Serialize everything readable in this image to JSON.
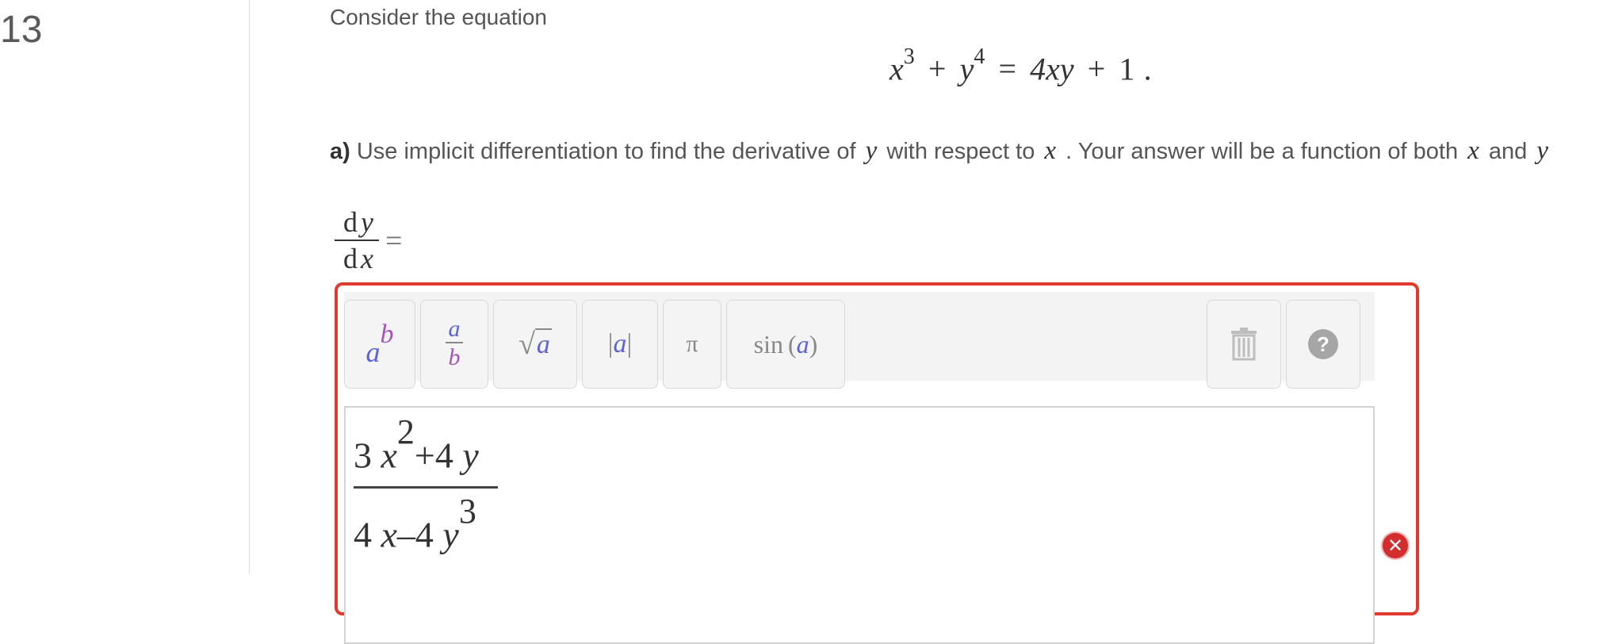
{
  "question": {
    "number": "13",
    "intro": "Consider the equation",
    "equation": {
      "x_var": "x",
      "x_exp": "3",
      "plus": "+",
      "y_var": "y",
      "y_exp": "4",
      "equals": "=",
      "rhs": "4xy",
      "plus2": "+",
      "const": "1",
      "period": "."
    },
    "part_a": {
      "label": "a)",
      "text_1": "Use implicit differentiation to find the derivative of",
      "var_y": "y",
      "text_2": "with respect to",
      "var_x": "x",
      "text_3": ". Your answer will be a function of both",
      "var_x2": "x",
      "text_4": "and",
      "var_y2": "y"
    },
    "derivative_label": {
      "numerator_d": "d",
      "numerator_var": "y",
      "denominator_d": "d",
      "denominator_var": "x",
      "equals": "="
    }
  },
  "toolbar": {
    "power": {
      "base": "a",
      "exp": "b"
    },
    "fraction": {
      "num": "a",
      "den": "b"
    },
    "sqrt": {
      "radical": "√",
      "arg": "a"
    },
    "abs": {
      "bar": "|",
      "arg": "a"
    },
    "pi": "π",
    "sin": {
      "fn": "sin",
      "open": "(",
      "arg": "a",
      "close": ")"
    },
    "help": "?"
  },
  "answer": {
    "numerator": {
      "coef": "3",
      "var": "x",
      "exp": "2",
      "rest": "+4",
      "var2": "y"
    },
    "denominator": {
      "coef": "4",
      "var": "x",
      "rest": "–4",
      "var2": "y",
      "exp": "3"
    }
  },
  "status": {
    "error_symbol": "✕"
  },
  "colors": {
    "error_border": "#e03a2f",
    "variable_blue": "#5b63d8",
    "variable_purple": "#a356b8"
  }
}
